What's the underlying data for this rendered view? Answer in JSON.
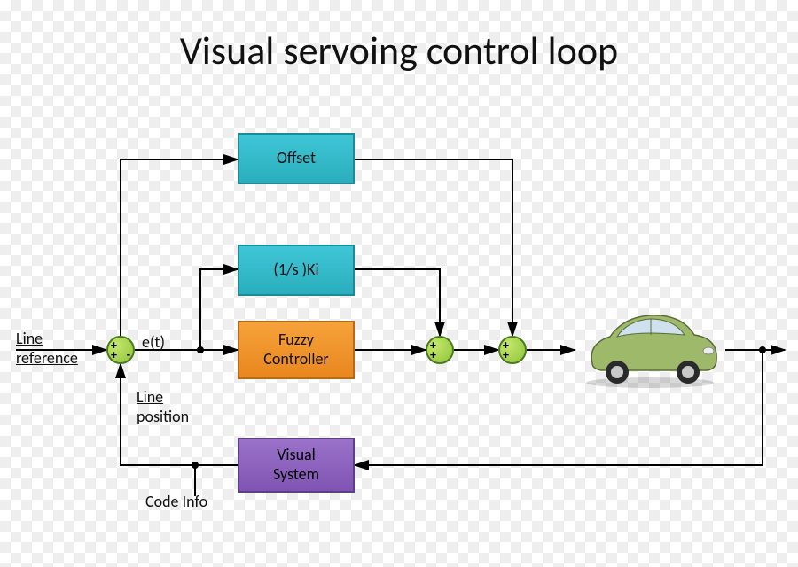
{
  "title": "Visual servoing control loop",
  "blocks": {
    "offset": {
      "label": "Offset"
    },
    "ki": {
      "label": "(1/s )Ki"
    },
    "fuzzy": {
      "label": "Fuzzy\nController"
    },
    "visual": {
      "label": "Visual\nSystem"
    }
  },
  "labels": {
    "line_ref": "Line\nreference",
    "error": "e(t)",
    "line_pos": "Line\nposition",
    "code_info": "Code Info"
  },
  "sum_nodes": {
    "s1": {
      "tl": "+",
      "bl": "+",
      "br": "-"
    },
    "s2": {
      "tl": "+",
      "bl": "+"
    },
    "s3": {
      "tl": "+",
      "bl": "+"
    }
  },
  "plant": {
    "name": "car"
  }
}
